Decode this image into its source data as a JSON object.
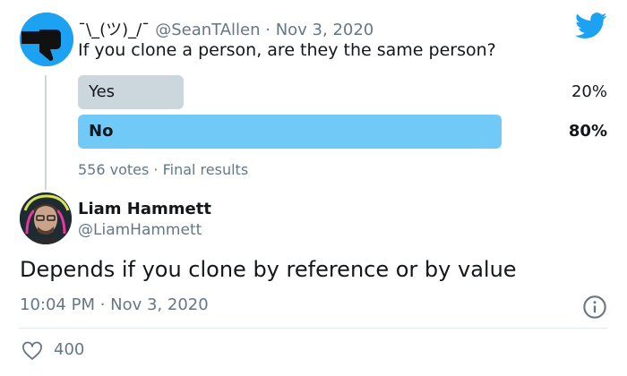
{
  "quoted_tweet": {
    "display_name": "¯\\_(ツ)_/¯",
    "handle": "@SeanTAllen",
    "date": "Nov 3, 2020",
    "text": "If you clone a person, are they the same person?",
    "poll": {
      "options": [
        {
          "label": "Yes",
          "percent": "20%",
          "fraction": 0.2
        },
        {
          "label": "No",
          "percent": "80%",
          "fraction": 0.8
        }
      ],
      "footer": "556 votes · Final results"
    }
  },
  "reply_tweet": {
    "display_name": "Liam Hammett",
    "handle": "@LiamHammett",
    "text": "Depends if you clone by reference or by value",
    "timestamp": "10:04 PM · Nov 3, 2020",
    "likes": "400"
  },
  "colors": {
    "twitter_blue": "#1da1f2",
    "poll_winner": "#71c9f8",
    "poll_loser": "#ccd6dd",
    "muted_text": "#657786"
  },
  "icons": {
    "brand": "twitter-bird-icon",
    "info": "info-icon",
    "like": "heart-icon"
  }
}
